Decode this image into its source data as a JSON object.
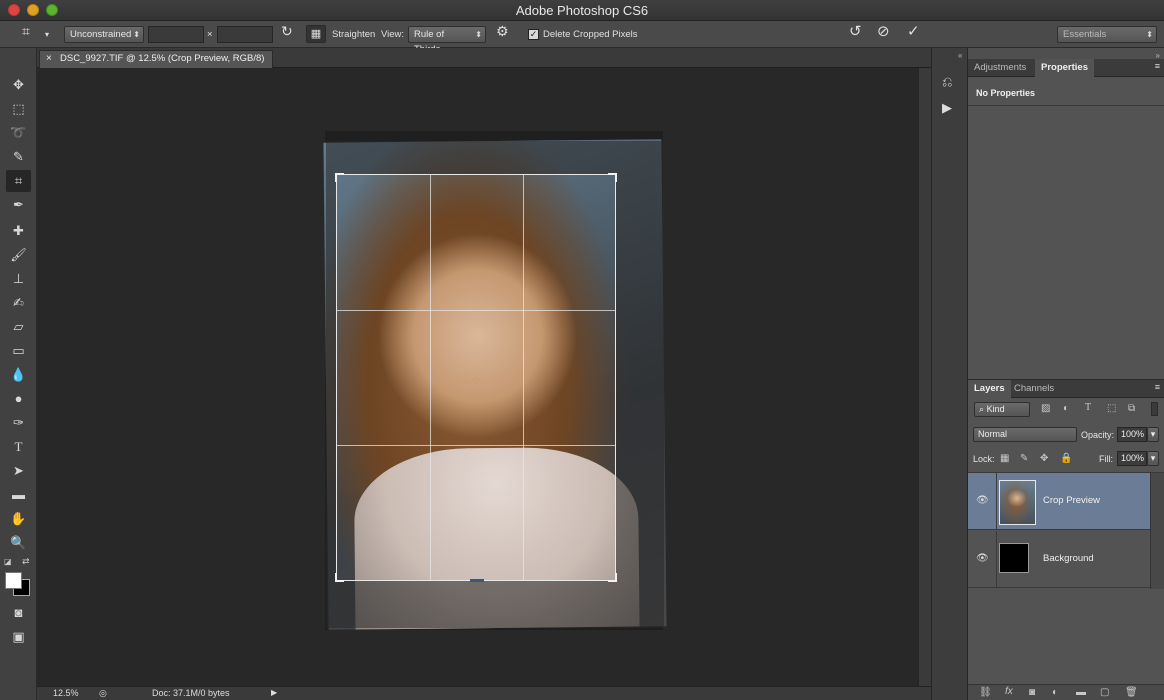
{
  "window": {
    "title": "Adobe Photoshop CS6"
  },
  "options_bar": {
    "ratio_select": "Unconstrained",
    "width_value": "",
    "height_value": "",
    "times_sign": "×",
    "straighten_label": "Straighten",
    "view_label": "View:",
    "view_select": "Rule of Thirds",
    "delete_cropped_label": "Delete Cropped Pixels",
    "delete_cropped_checked": "✓",
    "workspace_select": "Essentials"
  },
  "document": {
    "tab_label": "DSC_9927.TIF @ 12.5% (Crop Preview, RGB/8)",
    "close_glyph": "×"
  },
  "status_bar": {
    "zoom": "12.5%",
    "doc_info": "Doc: 37.1M/0 bytes"
  },
  "properties_panel": {
    "tabs": [
      "Adjustments",
      "Properties"
    ],
    "active_tab": "Properties",
    "content": "No Properties"
  },
  "layers_panel": {
    "tabs": [
      "Layers",
      "Channels"
    ],
    "active_tab": "Layers",
    "filter_kind": "Kind",
    "blend_mode": "Normal",
    "opacity_label": "Opacity:",
    "opacity_value": "100%",
    "lock_label": "Lock:",
    "fill_label": "Fill:",
    "fill_value": "100%",
    "layers": [
      {
        "name": "Crop Preview",
        "visible": true,
        "selected": true
      },
      {
        "name": "Background",
        "visible": true,
        "selected": false
      }
    ]
  },
  "colors": {
    "selected_layer": "#6b7c96",
    "accent": "#e8e8e8"
  }
}
